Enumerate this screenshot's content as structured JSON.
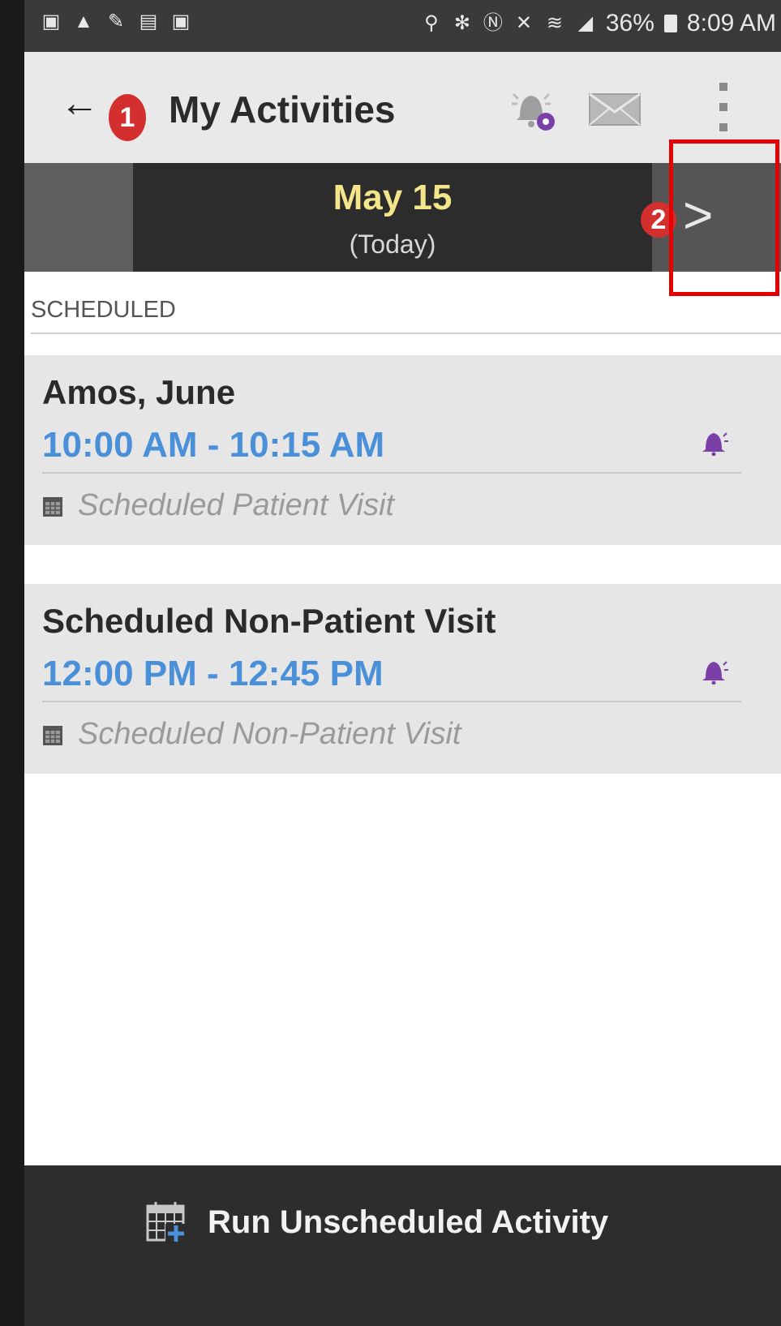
{
  "status_bar": {
    "left_icons": [
      "notification-icon",
      "warning-icon",
      "wrench-icon",
      "image-icon",
      "notification-icon"
    ],
    "right_icons": [
      "location-icon",
      "bluetooth-icon",
      "nfc-icon",
      "mute-icon",
      "wifi-icon",
      "signal-icon"
    ],
    "battery": "36%",
    "time": "8:09 AM"
  },
  "app_bar": {
    "title": "My Activities",
    "badge_1": "1",
    "icons": [
      "back-arrow-icon",
      "bell-add-icon",
      "mail-icon",
      "overflow-menu-icon"
    ]
  },
  "date_bar": {
    "date": "May 15",
    "sub": "(Today)",
    "badge_2": "2",
    "next_icon": "chevron-right-icon"
  },
  "section": {
    "header": "SCHEDULED"
  },
  "activities": [
    {
      "title": "Amos, June",
      "time": "10:00 AM - 10:15 AM",
      "type": "Scheduled Patient Visit"
    },
    {
      "title": "Scheduled Non-Patient Visit",
      "time": "12:00 PM - 12:45 PM",
      "type": "Scheduled Non-Patient Visit"
    }
  ],
  "bottom_bar": {
    "label": "Run Unscheduled Activity",
    "icon": "calendar-add-icon"
  },
  "colors": {
    "accent_time": "#4a90d9",
    "date_text": "#f4e48a",
    "badge": "#d32f2f",
    "highlight": "#e60000",
    "alarm_icon": "#7b3fa8"
  }
}
